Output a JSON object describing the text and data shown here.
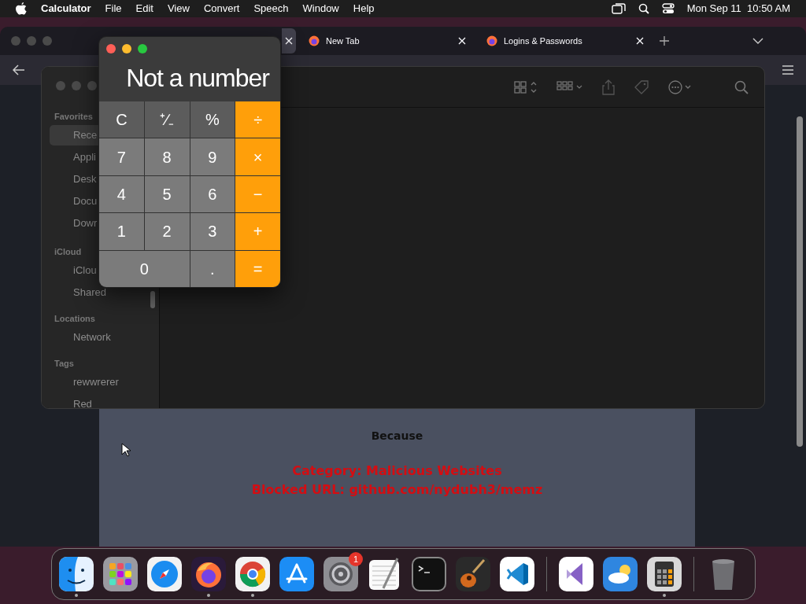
{
  "menubar": {
    "app": "Calculator",
    "menus": [
      "File",
      "Edit",
      "View",
      "Convert",
      "Speech",
      "Window",
      "Help"
    ],
    "clock": "Mon Sep 11  10:50 AM"
  },
  "browser": {
    "tabs": [
      {
        "selected": true
      },
      {
        "label": "New Tab",
        "selected": false
      },
      {
        "label": "Logins & Passwords",
        "selected": false
      }
    ],
    "page": {
      "heading": "Because",
      "lines": [
        "Category: Malicious Websites",
        "Blocked URL: github.com/nydubh3/memz"
      ]
    }
  },
  "finder": {
    "sections": [
      {
        "heading": "Favorites",
        "items": [
          {
            "label": "Rece",
            "selected": true
          },
          {
            "label": "Appli",
            "selected": false
          },
          {
            "label": "Desk",
            "selected": false
          },
          {
            "label": "Docu",
            "selected": false
          },
          {
            "label": "Dowr",
            "selected": false
          }
        ]
      },
      {
        "heading": "iCloud",
        "items": [
          {
            "label": "iClou",
            "selected": false
          },
          {
            "label": "Shared",
            "selected": false
          }
        ]
      },
      {
        "heading": "Locations",
        "items": [
          {
            "label": "Network",
            "selected": false
          }
        ]
      },
      {
        "heading": "Tags",
        "items": [
          {
            "label": "rewwrerer",
            "selected": false
          },
          {
            "label": "Red",
            "selected": false
          }
        ]
      }
    ]
  },
  "calculator": {
    "display": "Not a number",
    "keys": [
      {
        "label": "C",
        "kind": "function",
        "wide": false
      },
      {
        "label": "⁺∕₋",
        "kind": "function",
        "wide": false
      },
      {
        "label": "%",
        "kind": "function",
        "wide": false
      },
      {
        "label": "÷",
        "kind": "operator",
        "wide": false
      },
      {
        "label": "7",
        "kind": "digit",
        "wide": false
      },
      {
        "label": "8",
        "kind": "digit",
        "wide": false
      },
      {
        "label": "9",
        "kind": "digit",
        "wide": false
      },
      {
        "label": "×",
        "kind": "operator",
        "wide": false
      },
      {
        "label": "4",
        "kind": "digit",
        "wide": false
      },
      {
        "label": "5",
        "kind": "digit",
        "wide": false
      },
      {
        "label": "6",
        "kind": "digit",
        "wide": false
      },
      {
        "label": "−",
        "kind": "operator",
        "wide": false
      },
      {
        "label": "1",
        "kind": "digit",
        "wide": false
      },
      {
        "label": "2",
        "kind": "digit",
        "wide": false
      },
      {
        "label": "3",
        "kind": "digit",
        "wide": false
      },
      {
        "label": "+",
        "kind": "operator",
        "wide": false
      },
      {
        "label": "0",
        "kind": "digit",
        "wide": true
      },
      {
        "label": ".",
        "kind": "digit",
        "wide": false
      },
      {
        "label": "=",
        "kind": "operator",
        "wide": false
      }
    ]
  },
  "dock": {
    "items": [
      {
        "kind": "finder",
        "running": true
      },
      {
        "kind": "launchpad",
        "running": false
      },
      {
        "kind": "safari",
        "running": false
      },
      {
        "kind": "firefox",
        "running": true
      },
      {
        "kind": "chrome",
        "running": true
      },
      {
        "kind": "appstore",
        "running": false
      },
      {
        "kind": "settings",
        "running": false,
        "badge": "1"
      },
      {
        "kind": "textedit",
        "running": false
      },
      {
        "kind": "terminal",
        "running": false
      },
      {
        "kind": "guitar",
        "running": false
      },
      {
        "kind": "vscode",
        "running": false
      },
      {
        "kind": "separator"
      },
      {
        "kind": "vs",
        "running": false
      },
      {
        "kind": "weather",
        "running": false
      },
      {
        "kind": "calculator",
        "running": true
      },
      {
        "kind": "separator"
      },
      {
        "kind": "trash",
        "running": false
      }
    ]
  }
}
